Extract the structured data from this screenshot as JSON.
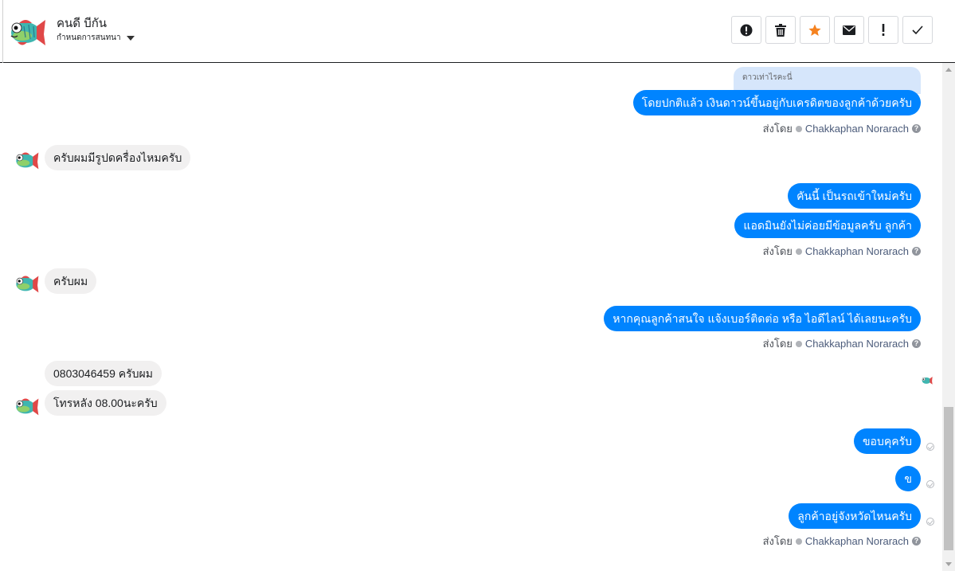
{
  "header": {
    "contact_name": "คนดี บีกัน",
    "stage_label": "กำหนดการสนทนา"
  },
  "actions": [
    {
      "name": "alert-circle-icon",
      "color": "#1c1e21"
    },
    {
      "name": "trash-icon",
      "color": "#1c1e21"
    },
    {
      "name": "star-icon",
      "color": "#f5821f"
    },
    {
      "name": "mail-icon",
      "color": "#1c1e21"
    },
    {
      "name": "exclamation-icon",
      "color": "#1c1e21"
    },
    {
      "name": "check-icon",
      "color": "#1c1e21"
    }
  ],
  "messages": {
    "quoted_text": "ดาวเท่าไรคะนี่",
    "m1": "โดยปกติแล้ว เงินดาวน์ขึ้นอยู่กับเครดิตของลูกค้าด้วยครับ",
    "m2": "ครับผมมีรูปดครื่องไหมครับ",
    "m3": "คันนี้ เป็นรถเข้าใหม่ครับ",
    "m4": "แอดมินยังไม่ค่อยมีข้อมูลครับ ลูกค้า",
    "m5": "ครับผม",
    "m6": "หากคุณลูกค้าสนใจ แจ้งเบอร์ติดต่อ หรือ ไอดีไลน์ ได้เลยนะครับ",
    "m7": "0803046459 ครับผม",
    "m8": "โทรหลัง 08.00นะครับ",
    "m9": "ขอบคุครับ",
    "m10": "ข",
    "m11": "ลูกค้าอยู่จังหวัดไหนครับ"
  },
  "sent_by": {
    "prefix": "ส่งโดย",
    "agent": "Chakkaphan Norarach",
    "help": "?"
  },
  "colors": {
    "outgoing": "#0084ff",
    "incoming": "#f1f0f0",
    "accent_star": "#f5821f"
  }
}
